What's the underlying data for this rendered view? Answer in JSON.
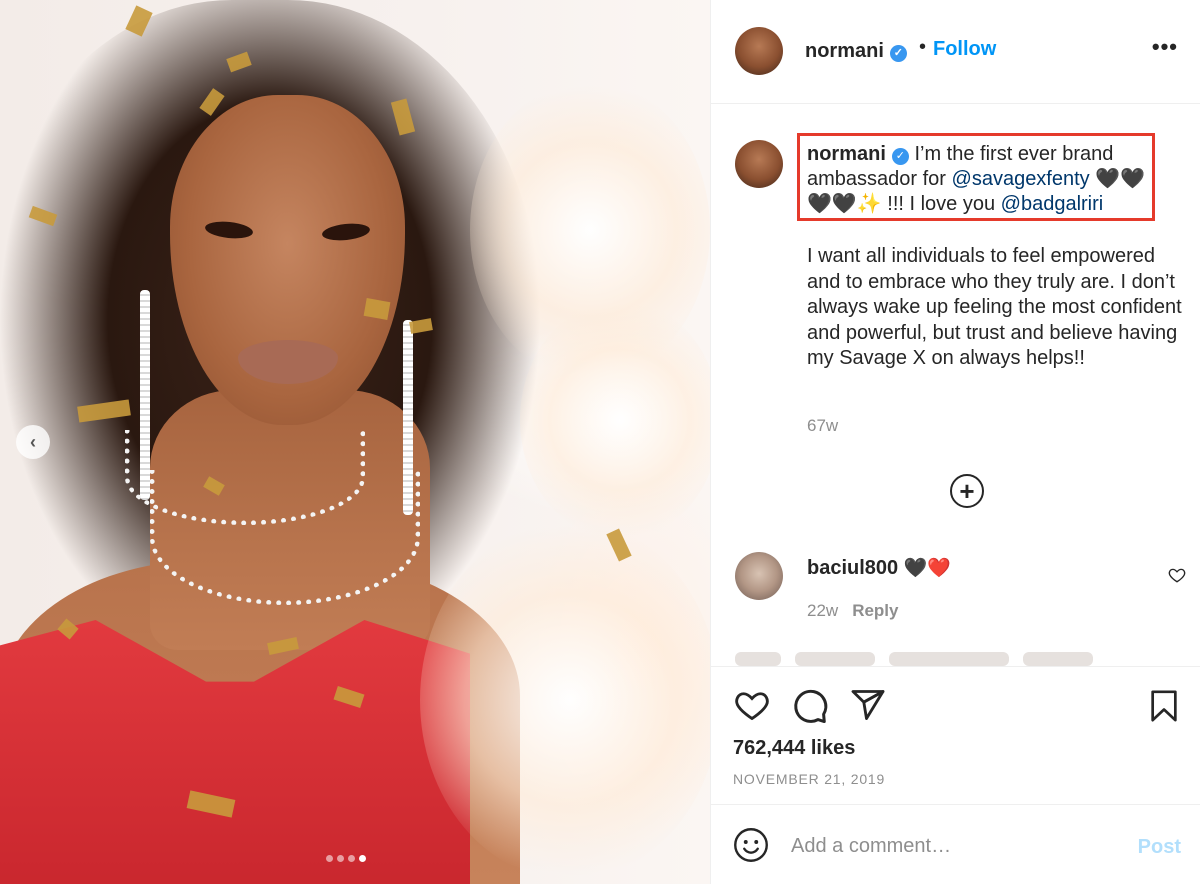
{
  "post": {
    "media": {
      "prev_icon": "‹",
      "slides_count": 4,
      "active_slide": 4
    },
    "header": {
      "username": "normani",
      "verified_icon": "✓",
      "separator": "•",
      "follow_label": "Follow",
      "more_icon": "•••"
    },
    "caption": {
      "username": "normani",
      "text_1": " I’m the first ever brand ambassador for ",
      "mention_1": "@savagexfenty",
      "text_2": " 🖤🖤🖤🖤✨ !!! I love you ",
      "mention_2": "@badgalriri",
      "body": "I want all individuals to feel empowered and to embrace who they truly are. I don’t always wake up feeling the most confident and powerful, but trust and believe having my Savage X on always helps!!",
      "time_ago": "67w",
      "highlight_color": "#e53a2b"
    },
    "load_more_icon": "+",
    "comments": [
      {
        "username": "baciul800",
        "text": " 🖤❤️",
        "time_ago": "22w",
        "reply_label": "Reply"
      }
    ],
    "likes": "762,444 likes",
    "date": "NOVEMBER 21, 2019",
    "add_comment": {
      "placeholder": "Add a comment…",
      "post_label": "Post"
    },
    "colors": {
      "accent": "#0095f6",
      "verified": "#3897f0",
      "post_disabled": "#b2dffc",
      "mention": "#00376b"
    }
  }
}
